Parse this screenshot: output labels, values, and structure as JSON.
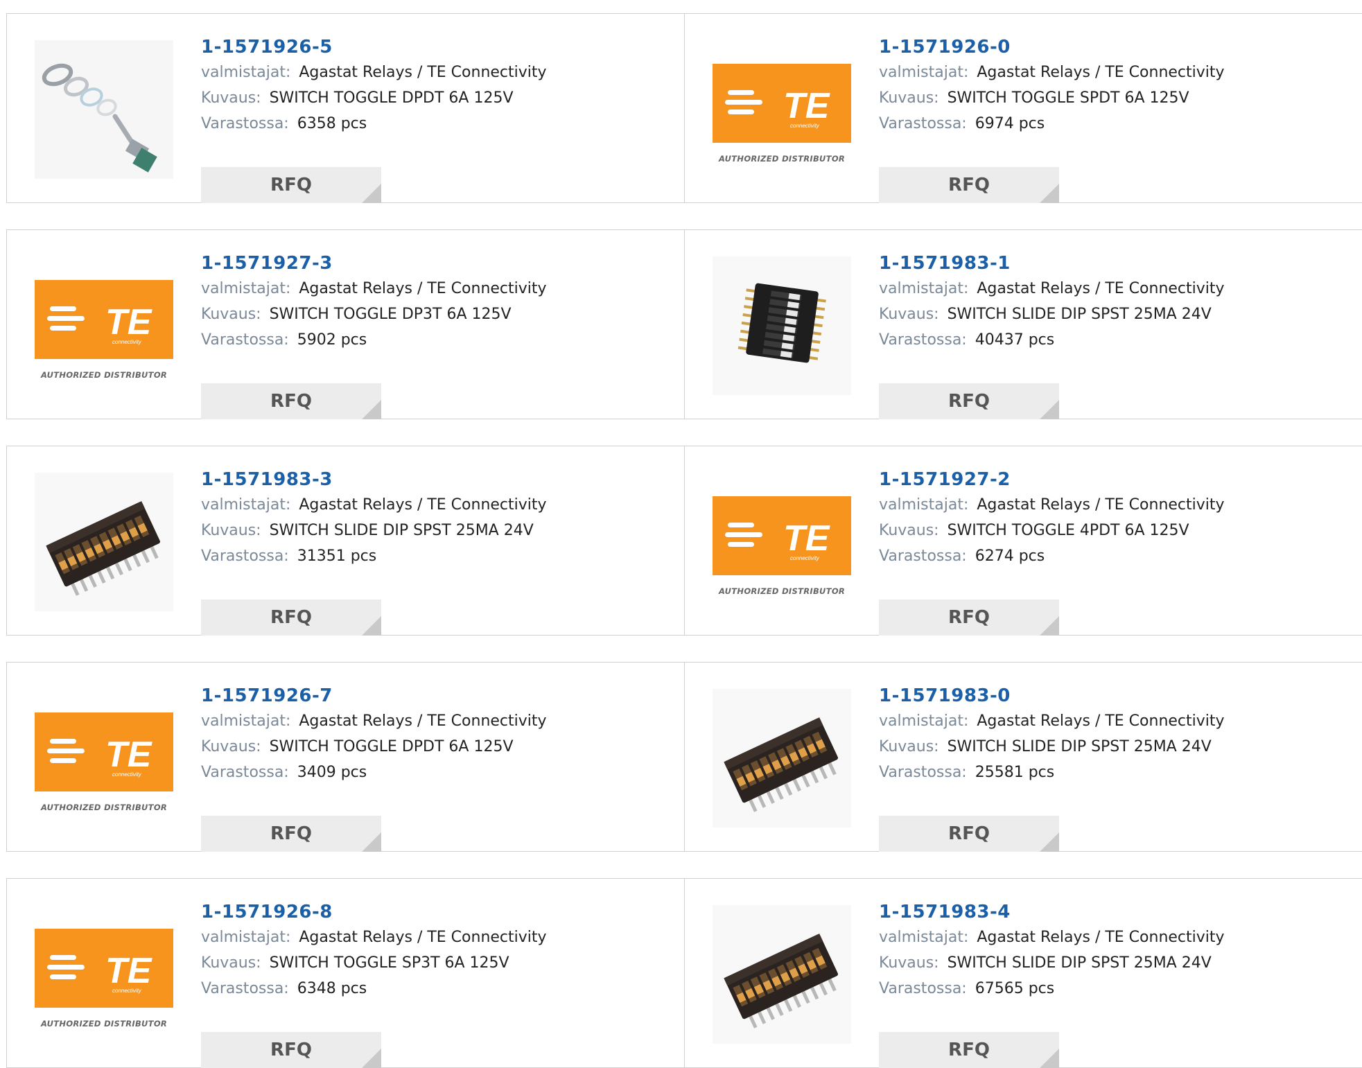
{
  "labels": {
    "manufacturer": "valmistajat:",
    "description": "Kuvaus:",
    "stock": "Varastossa:",
    "rfq": "RFQ"
  },
  "logo": {
    "brand": "TE",
    "subtitle": "connectivity",
    "caption": "AUTHORIZED DISTRIBUTOR",
    "color": "#F7941D"
  },
  "colors": {
    "part_link": "#1a5fa8",
    "label": "#7a8898",
    "border": "#cfcfcf",
    "button_bg": "#ececec"
  },
  "products": [
    {
      "part": "1-1571926-5",
      "manufacturer": "Agastat Relays / TE Connectivity",
      "description": "SWITCH TOGGLE DPDT 6A 125V",
      "stock": "6358 pcs",
      "image": "toggle-switch-photo"
    },
    {
      "part": "1-1571926-0",
      "manufacturer": "Agastat Relays / TE Connectivity",
      "description": "SWITCH TOGGLE SPDT 6A 125V",
      "stock": "6974 pcs",
      "image": "te-logo"
    },
    {
      "part": "1-1571927-3",
      "manufacturer": "Agastat Relays / TE Connectivity",
      "description": "SWITCH TOGGLE DP3T 6A 125V",
      "stock": "5902 pcs",
      "image": "te-logo"
    },
    {
      "part": "1-1571983-1",
      "manufacturer": "Agastat Relays / TE Connectivity",
      "description": "SWITCH SLIDE DIP SPST 25MA 24V",
      "stock": "40437 pcs",
      "image": "dip-switch-top-photo"
    },
    {
      "part": "1-1571983-3",
      "manufacturer": "Agastat Relays / TE Connectivity",
      "description": "SWITCH SLIDE DIP SPST 25MA 24V",
      "stock": "31351 pcs",
      "image": "dip-switch-angled-photo"
    },
    {
      "part": "1-1571927-2",
      "manufacturer": "Agastat Relays / TE Connectivity",
      "description": "SWITCH TOGGLE 4PDT 6A 125V",
      "stock": "6274 pcs",
      "image": "te-logo"
    },
    {
      "part": "1-1571926-7",
      "manufacturer": "Agastat Relays / TE Connectivity",
      "description": "SWITCH TOGGLE DPDT 6A 125V",
      "stock": "3409 pcs",
      "image": "te-logo"
    },
    {
      "part": "1-1571983-0",
      "manufacturer": "Agastat Relays / TE Connectivity",
      "description": "SWITCH SLIDE DIP SPST 25MA 24V",
      "stock": "25581 pcs",
      "image": "dip-switch-angled-photo"
    },
    {
      "part": "1-1571926-8",
      "manufacturer": "Agastat Relays / TE Connectivity",
      "description": "SWITCH TOGGLE SP3T 6A 125V",
      "stock": "6348 pcs",
      "image": "te-logo"
    },
    {
      "part": "1-1571983-4",
      "manufacturer": "Agastat Relays / TE Connectivity",
      "description": "SWITCH SLIDE DIP SPST 25MA 24V",
      "stock": "67565 pcs",
      "image": "dip-switch-angled-photo"
    }
  ]
}
